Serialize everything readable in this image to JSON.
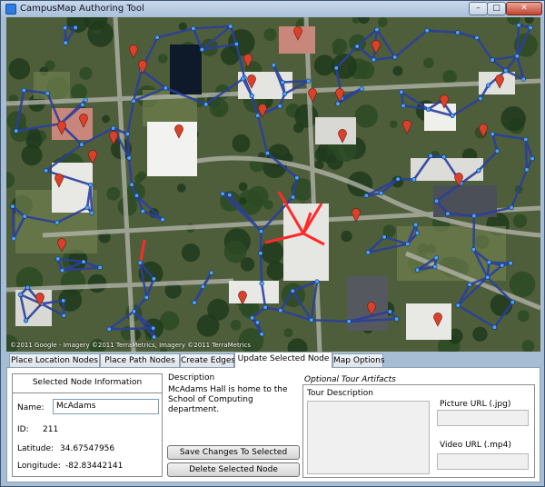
{
  "window": {
    "title": "CampusMap Authoring Tool",
    "min_glyph": "–",
    "max_glyph": "□",
    "close_glyph": "✕"
  },
  "map": {
    "attribution": "©2011 Google - Imagery ©2011 TerraMetrics, Imagery ©2011 TerraMetrics"
  },
  "tabs": [
    {
      "label": "Place Location Nodes"
    },
    {
      "label": "Place Path Nodes"
    },
    {
      "label": "Create Edges"
    },
    {
      "label": "Update Selected Node"
    },
    {
      "label": "Map Options"
    }
  ],
  "selected_node": {
    "header": "Selected Node Information",
    "name_label": "Name:",
    "name_value": "McAdams",
    "id_label": "ID:",
    "id_value": "211",
    "latitude_label": "Latitude:",
    "latitude_value": "34.67547956",
    "longitude_label": "Longitude:",
    "longitude_value": "-82.83442141"
  },
  "description": {
    "label": "Description",
    "text": "McAdams Hall is home to the School of Computing department."
  },
  "buttons": {
    "save": "Save Changes To Selected",
    "delete": "Delete Selected Node"
  },
  "artifacts": {
    "header": "Optional Tour Artifacts",
    "tour_description_label": "Tour Description",
    "picture_label": "Picture URL (.jpg)",
    "video_label": "Video URL (.mp4)"
  },
  "colors": {
    "path_edge": "#2b3f9c",
    "selected_edge": "#ff2a2a",
    "node": "#4aa3ff",
    "pin": "#d9412b"
  }
}
